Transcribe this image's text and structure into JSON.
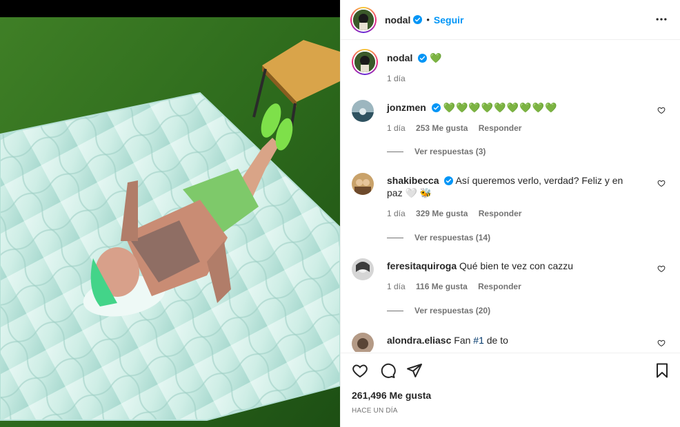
{
  "post": {
    "author": "nodal",
    "follow_label": "Seguir",
    "separator": "•",
    "caption_emoji": "💚",
    "caption_time": "1 día",
    "likes": "261,496 Me gusta",
    "timestamp": "HACE UN DÍA"
  },
  "comments": [
    {
      "user": "jonzmen",
      "verified": true,
      "text": "💚💚💚💚💚💚💚💚💚",
      "time": "1 día",
      "likes": "253 Me gusta",
      "reply": "Responder",
      "view_replies": "Ver respuestas (3)"
    },
    {
      "user": "shakibecca",
      "verified": true,
      "text": "Así queremos verlo, verdad? Feliz y en paz 🤍 🐝",
      "time": "1 día",
      "likes": "329 Me gusta",
      "reply": "Responder",
      "view_replies": "Ver respuestas (14)"
    },
    {
      "user": "feresitaquiroga",
      "verified": false,
      "text": "Qué bien te vez con cazzu",
      "time": "1 día",
      "likes": "116 Me gusta",
      "reply": "Responder",
      "view_replies": "Ver respuestas (20)"
    },
    {
      "user": "alondra.eliasc",
      "verified": false,
      "text": "Fan",
      "hashtag": "#1",
      "text_after": "de to"
    }
  ],
  "icons": {
    "more": "more-options-icon",
    "like": "heart-icon",
    "comment": "comment-icon",
    "share": "share-icon",
    "save": "bookmark-icon",
    "verified": "verified-badge-icon"
  },
  "colors": {
    "accent": "#0095f6",
    "text": "#262626",
    "muted": "#737373",
    "verified": "#0095f6",
    "heart_emoji": "#3aa829"
  }
}
